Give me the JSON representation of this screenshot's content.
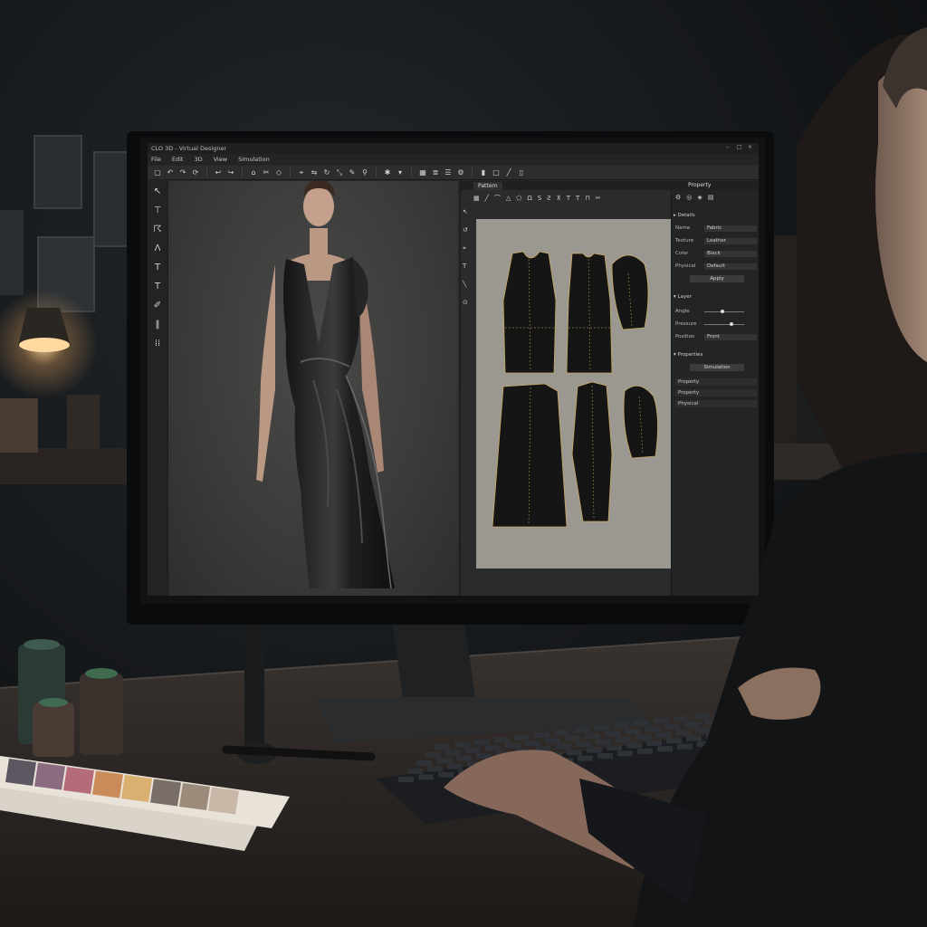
{
  "app": {
    "window_title": "CLO 3D - Virtual Designer",
    "menu": [
      "File",
      "Edit",
      "3D",
      "View",
      "Simulation"
    ],
    "pattern_tab_label": "Pattern",
    "property_tab_label": "Property",
    "props_rows": [
      {
        "label": "Name",
        "value": "Fabric"
      },
      {
        "label": "Texture",
        "value": "Leather"
      },
      {
        "label": "Color",
        "value": "Black"
      },
      {
        "label": "Physical",
        "value": "Default"
      }
    ],
    "props_button": "Apply",
    "section_details": "Details",
    "section_layer": "Layer",
    "slider_rows": [
      {
        "label": "Angle",
        "value": "0"
      },
      {
        "label": "Pressure",
        "value": "10"
      },
      {
        "label": "Position",
        "value": "Front"
      }
    ],
    "section_properties": "Properties",
    "props_button_2": "Simulation",
    "collapse_rows": [
      "Property",
      "Property",
      "Physical"
    ]
  },
  "colors": {
    "ui_bg": "#262729",
    "pattern_sheet": "#9b9891",
    "fabric": "#1c1c1c",
    "stitch_line": "#c8a860",
    "lamp_glow": "#ffd9a0"
  },
  "icons": [
    "select-icon",
    "move-icon",
    "rotate-icon",
    "pen-icon",
    "text-icon",
    "sew-icon",
    "fold-icon"
  ]
}
